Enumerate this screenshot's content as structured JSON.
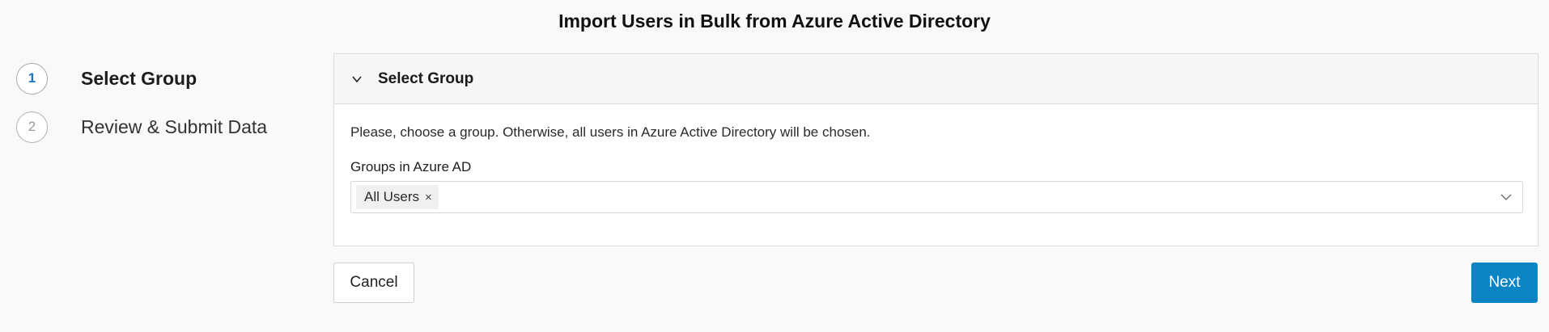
{
  "page": {
    "title": "Import Users in Bulk from Azure Active Directory"
  },
  "stepper": {
    "steps": [
      {
        "number": "1",
        "label": "Select Group",
        "state": "active"
      },
      {
        "number": "2",
        "label": "Review & Submit Data",
        "state": "inactive"
      }
    ]
  },
  "panel": {
    "title": "Select Group",
    "description": "Please, choose a group. Otherwise, all users in Azure Active Directory will be chosen.",
    "groups_field": {
      "label": "Groups in Azure AD",
      "selected_tags": [
        "All Users"
      ],
      "remove_glyph": "×"
    }
  },
  "actions": {
    "cancel_label": "Cancel",
    "next_label": "Next"
  },
  "colors": {
    "accent": "#0b84c4",
    "active_step_number": "#1a73c8",
    "background": "#f9f9f9"
  },
  "icons": {
    "panel_toggle": "chevron-down-icon",
    "select_dropdown": "chevron-down-icon",
    "tag_remove": "close-icon"
  }
}
